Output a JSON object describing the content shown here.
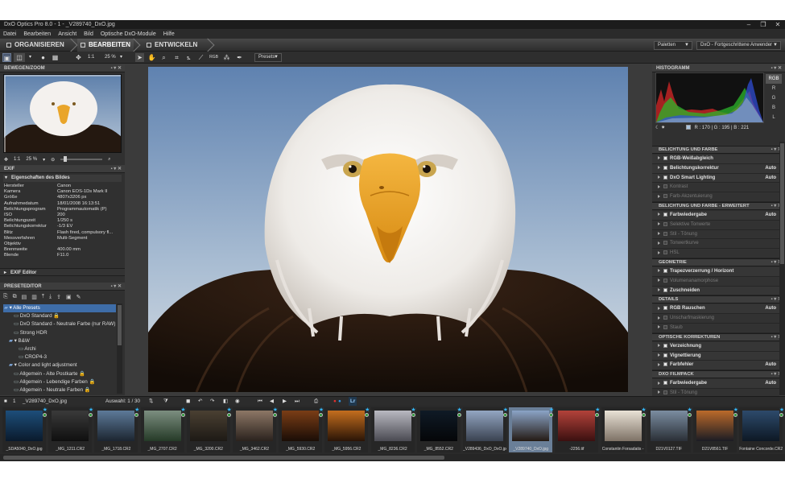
{
  "window": {
    "title": "DxO Optics Pro 8.0 - 1 - _V289740_DxO.jpg",
    "controls": [
      "–",
      "❐",
      "✕"
    ]
  },
  "menu": [
    "Datei",
    "Bearbeiten",
    "Ansicht",
    "Bild",
    "Optische DxO-Module",
    "Hilfe"
  ],
  "modes": {
    "organize": "ORGANISIEREN",
    "edit": "BEARBEITEN",
    "develop": "ENTWICKELN"
  },
  "right_dropdowns": {
    "palettes": "Paletten",
    "workspace": "DxO - Fortgeschrittene Anwender"
  },
  "toolbar": {
    "ratio": "1:1",
    "zoom": "25 %",
    "presets": "Presets"
  },
  "left": {
    "nav": {
      "title": "BEWEGEN/ZOOM",
      "ratio": "1:1",
      "zoom": "25 %"
    },
    "exif": {
      "title": "EXIF",
      "group": "Eigenschaften des Bildes",
      "rows": [
        [
          "Hersteller",
          "Canon"
        ],
        [
          "Kamera",
          "Canon EOS-1Ds Mark II"
        ],
        [
          "Größe",
          "4807x3206 px"
        ],
        [
          "Aufnahmedatum",
          "18/01/2008 16:13:51"
        ],
        [
          "Belichtungsprogram",
          "Programmautomatik (P)"
        ],
        [
          "ISO",
          "200"
        ],
        [
          "Belichtungszeit",
          "1/250 s"
        ],
        [
          "Belichtungskorrektur",
          "-1/3 EV"
        ],
        [
          "Blitz",
          "Flash fired, compulsory fl..."
        ],
        [
          "Messverfahren",
          "Multi-Segment"
        ],
        [
          "Objektiv",
          ""
        ],
        [
          "Brennweite",
          "400.00 mm"
        ],
        [
          "Blende",
          "F11.0"
        ]
      ]
    },
    "exif_editor": "EXIF Editor",
    "presets": {
      "title": "PRESETEDITOR",
      "items": [
        [
          "▾ Alle Presets",
          0,
          true
        ],
        [
          "DxO Standard 🔒",
          2,
          false
        ],
        [
          "DxO Standard - Neutrale Farbe (nur RAW) 🔒",
          2,
          false
        ],
        [
          "Strong HDR",
          2,
          false
        ],
        [
          "▾ B&W",
          1,
          false
        ],
        [
          "Archi",
          3,
          false
        ],
        [
          "CROP4-3",
          3,
          false
        ],
        [
          "▾ Color and light adjustment",
          1,
          false
        ],
        [
          "Allgemein - Alte Postkarte 🔒",
          2,
          false
        ],
        [
          "Allgemein - Lebendige Farben 🔒",
          2,
          false
        ],
        [
          "Allgemein - Neutrale Farben 🔒",
          2,
          false
        ]
      ]
    }
  },
  "right": {
    "histogram": {
      "title": "HISTOGRAMM",
      "channels": [
        "RGB",
        "R",
        "G",
        "B",
        "L"
      ],
      "readout": "R : 170  |  G : 195  |  B : 221"
    },
    "sections": [
      {
        "title": "BELICHTUNG UND FARBE",
        "items": [
          [
            "RGB-Weißabgleich",
            true,
            ""
          ],
          [
            "Belichtungskorrektur",
            true,
            "Auto"
          ],
          [
            "DxO Smart Lighting",
            true,
            "Auto"
          ],
          [
            "Kontrast",
            false,
            ""
          ],
          [
            "Farb-Akzentuierung",
            false,
            ""
          ]
        ]
      },
      {
        "title": "BELICHTUNG UND FARBE - ERWEITERT",
        "items": [
          [
            "Farbwiedergabe",
            true,
            "Auto"
          ],
          [
            "Selektive Tonwerte",
            false,
            ""
          ],
          [
            "Stil - Tönung",
            false,
            ""
          ],
          [
            "Tonwertkurve",
            false,
            ""
          ],
          [
            "HSL",
            false,
            ""
          ]
        ]
      },
      {
        "title": "GEOMETRIE",
        "items": [
          [
            "Trapezverzerrung / Horizont",
            true,
            ""
          ],
          [
            "Volumenanamorphose",
            false,
            ""
          ],
          [
            "Zuschneiden",
            true,
            ""
          ]
        ]
      },
      {
        "title": "DETAILS",
        "items": [
          [
            "RGB Rauschen",
            true,
            "Auto"
          ],
          [
            "Unscharfmaskierung",
            false,
            ""
          ],
          [
            "Staub",
            false,
            ""
          ]
        ]
      },
      {
        "title": "OPTISCHE KORREKTUREN",
        "items": [
          [
            "Verzeichnung",
            true,
            ""
          ],
          [
            "Vignettierung",
            true,
            ""
          ],
          [
            "Farbfehler",
            true,
            "Auto"
          ]
        ]
      },
      {
        "title": "DXO FILMPACK",
        "items": [
          [
            "Farbwiedergabe",
            true,
            "Auto"
          ],
          [
            "Stil - Tönung",
            false,
            ""
          ],
          [
            "Filter",
            false,
            ""
          ]
        ]
      }
    ]
  },
  "filmstrip": {
    "folder": "_V289740_DxO.jpg",
    "count_label": "1",
    "selection": "Auswahl: 1 / 30",
    "lr": "Lr",
    "thumbs": [
      {
        "label": "_SDA5040_DxO.jpg",
        "colors": [
          "#1d4e7a",
          "#0a1a2c"
        ]
      },
      {
        "label": "_MG_1211.CR2",
        "colors": [
          "#3a3a3a",
          "#0f0f0f"
        ]
      },
      {
        "label": "_MG_1718.CR2",
        "colors": [
          "#5d7a99",
          "#1c2530"
        ]
      },
      {
        "label": "_MG_2707.CR2",
        "colors": [
          "#7c8e80",
          "#253a27"
        ]
      },
      {
        "label": "_MG_3200.CR2",
        "colors": [
          "#4a4032",
          "#1d1a15"
        ]
      },
      {
        "label": "_MG_3462.CR2",
        "colors": [
          "#8d7766",
          "#2a221d"
        ]
      },
      {
        "label": "_MG_5930.CR2",
        "colors": [
          "#7a3d16",
          "#1a0d06"
        ]
      },
      {
        "label": "_MG_5956.CR2",
        "colors": [
          "#c46e1e",
          "#2a1406"
        ]
      },
      {
        "label": "_MG_8236.CR2",
        "colors": [
          "#b9b9c1",
          "#4a4a52"
        ]
      },
      {
        "label": "_MG_8552.CR2",
        "colors": [
          "#0f1a26",
          "#050608"
        ]
      },
      {
        "label": "_V289436_DxO_DxO.jpg",
        "colors": [
          "#93a6c2",
          "#3a4250"
        ]
      },
      {
        "label": "_V289740_DxO.jpg",
        "colors": [
          "#8ba4c7",
          "#241a14"
        ]
      },
      {
        "label": "-2256.tif",
        "colors": [
          "#b3423a",
          "#3b1010"
        ]
      },
      {
        "label": "Constantin Forsadatis -",
        "colors": [
          "#e9e2d6",
          "#7e7266"
        ]
      },
      {
        "label": "D21V0127.TIF",
        "colors": [
          "#7b8da1",
          "#2a2f36"
        ]
      },
      {
        "label": "D21V8561.TIF",
        "colors": [
          "#bc6a2a",
          "#1b1c24"
        ]
      },
      {
        "label": "Fontaine Concorde.CR2",
        "colors": [
          "#2d4a6b",
          "#0d1824"
        ]
      }
    ]
  }
}
